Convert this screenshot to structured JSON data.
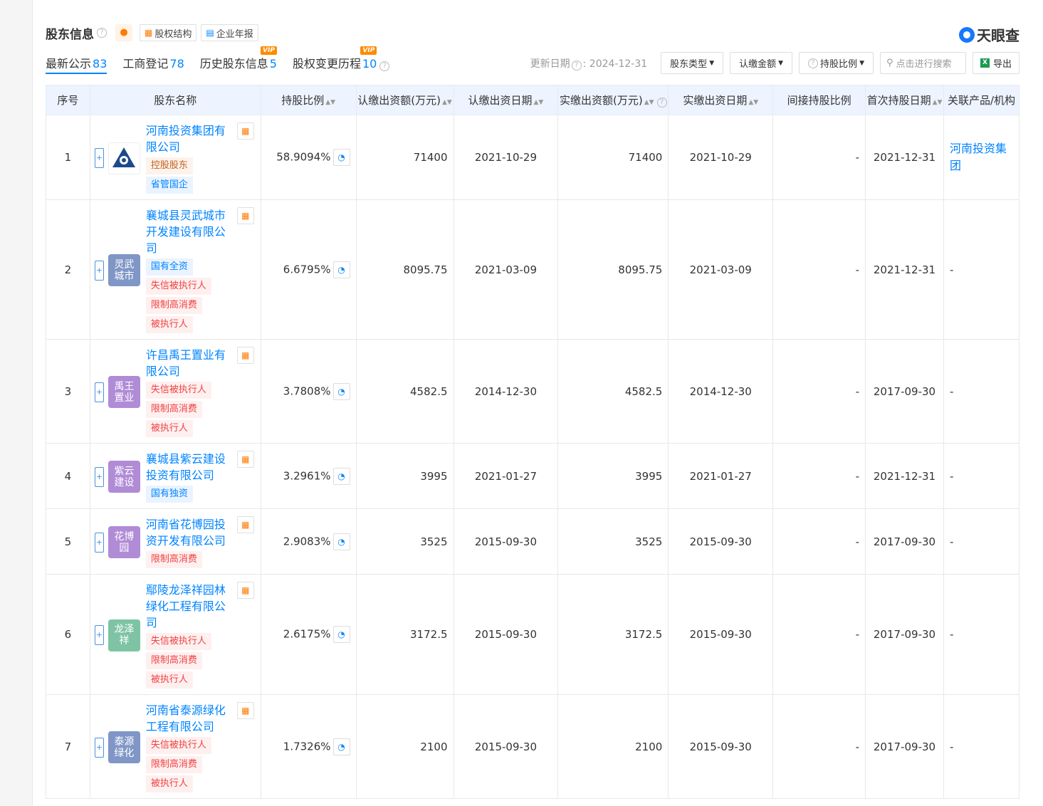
{
  "header": {
    "title": "股东信息",
    "buttons": [
      "股权结构",
      "企业年报"
    ],
    "logo": "天眼查"
  },
  "tabs": [
    {
      "label": "最新公示",
      "count": "83"
    },
    {
      "label": "工商登记",
      "count": "78"
    },
    {
      "label": "历史股东信息",
      "count": "5",
      "vip": "VIP"
    },
    {
      "label": "股权变更历程",
      "count": "10",
      "vip": "VIP"
    }
  ],
  "toolbar": {
    "update": "更新日期",
    "update_date": "2024-12-31",
    "filters": [
      "股东类型",
      "认缴金额",
      "持股比例"
    ],
    "search_placeholder": "点击进行搜索",
    "export": "导出"
  },
  "columns": [
    "序号",
    "股东名称",
    "持股比例",
    "认缴出资额(万元)",
    "认缴出资日期",
    "实缴出资额(万元)",
    "实缴出资日期",
    "间接持股比例",
    "首次持股日期",
    "关联产品/机构"
  ],
  "rows": [
    {
      "no": "1",
      "avatar": "",
      "avatar_color": "#ffffff",
      "name": "河南投资集团有限公司",
      "tags": [
        {
          "t": "控股股东",
          "c": "brown"
        },
        {
          "t": "省管国企",
          "c": "blue"
        }
      ],
      "ratio": "58.9094%",
      "sub_amt": "71400",
      "sub_date": "2021-10-29",
      "paid_amt": "71400",
      "paid_date": "2021-10-29",
      "indirect": "-",
      "first_date": "2021-12-31",
      "related": "河南投资集团"
    },
    {
      "no": "2",
      "avatar": "灵武城市",
      "avatar_color": "#7f96c6",
      "name": "襄城县灵武城市开发建设有限公司",
      "tags": [
        {
          "t": "国有全资",
          "c": "blue"
        },
        {
          "t": "失信被执行人",
          "c": "red"
        },
        {
          "t": "限制高消费",
          "c": "red"
        },
        {
          "t": "被执行人",
          "c": "red"
        }
      ],
      "ratio": "6.6795%",
      "sub_amt": "8095.75",
      "sub_date": "2021-03-09",
      "paid_amt": "8095.75",
      "paid_date": "2021-03-09",
      "indirect": "-",
      "first_date": "2021-12-31",
      "related": "-"
    },
    {
      "no": "3",
      "avatar": "禹王置业",
      "avatar_color": "#b08bd6",
      "name": "许昌禹王置业有限公司",
      "tags": [
        {
          "t": "失信被执行人",
          "c": "red"
        },
        {
          "t": "限制高消费",
          "c": "red"
        },
        {
          "t": "被执行人",
          "c": "red"
        }
      ],
      "ratio": "3.7808%",
      "sub_amt": "4582.5",
      "sub_date": "2014-12-30",
      "paid_amt": "4582.5",
      "paid_date": "2014-12-30",
      "indirect": "-",
      "first_date": "2017-09-30",
      "related": "-"
    },
    {
      "no": "4",
      "avatar": "紫云建设",
      "avatar_color": "#b08bd6",
      "name": "襄城县紫云建设投资有限公司",
      "tags": [
        {
          "t": "国有独资",
          "c": "blue"
        }
      ],
      "ratio": "3.2961%",
      "sub_amt": "3995",
      "sub_date": "2021-01-27",
      "paid_amt": "3995",
      "paid_date": "2021-01-27",
      "indirect": "-",
      "first_date": "2021-12-31",
      "related": "-"
    },
    {
      "no": "5",
      "avatar": "花博园",
      "avatar_color": "#b08bd6",
      "name": "河南省花博园投资开发有限公司",
      "tags": [
        {
          "t": "限制高消费",
          "c": "red"
        }
      ],
      "ratio": "2.9083%",
      "sub_amt": "3525",
      "sub_date": "2015-09-30",
      "paid_amt": "3525",
      "paid_date": "2015-09-30",
      "indirect": "-",
      "first_date": "2017-09-30",
      "related": "-"
    },
    {
      "no": "6",
      "avatar": "龙泽祥",
      "avatar_color": "#7ec4a4",
      "name": "鄢陵龙泽祥园林绿化工程有限公司",
      "tags": [
        {
          "t": "失信被执行人",
          "c": "red"
        },
        {
          "t": "限制高消费",
          "c": "red"
        },
        {
          "t": "被执行人",
          "c": "red"
        }
      ],
      "ratio": "2.6175%",
      "sub_amt": "3172.5",
      "sub_date": "2015-09-30",
      "paid_amt": "3172.5",
      "paid_date": "2015-09-30",
      "indirect": "-",
      "first_date": "2017-09-30",
      "related": "-"
    },
    {
      "no": "7",
      "avatar": "泰源绿化",
      "avatar_color": "#7f96c6",
      "name": "河南省泰源绿化工程有限公司",
      "tags": [
        {
          "t": "失信被执行人",
          "c": "red"
        },
        {
          "t": "限制高消费",
          "c": "red"
        },
        {
          "t": "被执行人",
          "c": "red"
        }
      ],
      "ratio": "1.7326%",
      "sub_amt": "2100",
      "sub_date": "2015-09-30",
      "paid_amt": "2100",
      "paid_date": "2015-09-30",
      "indirect": "-",
      "first_date": "2017-09-30",
      "related": "-"
    }
  ]
}
